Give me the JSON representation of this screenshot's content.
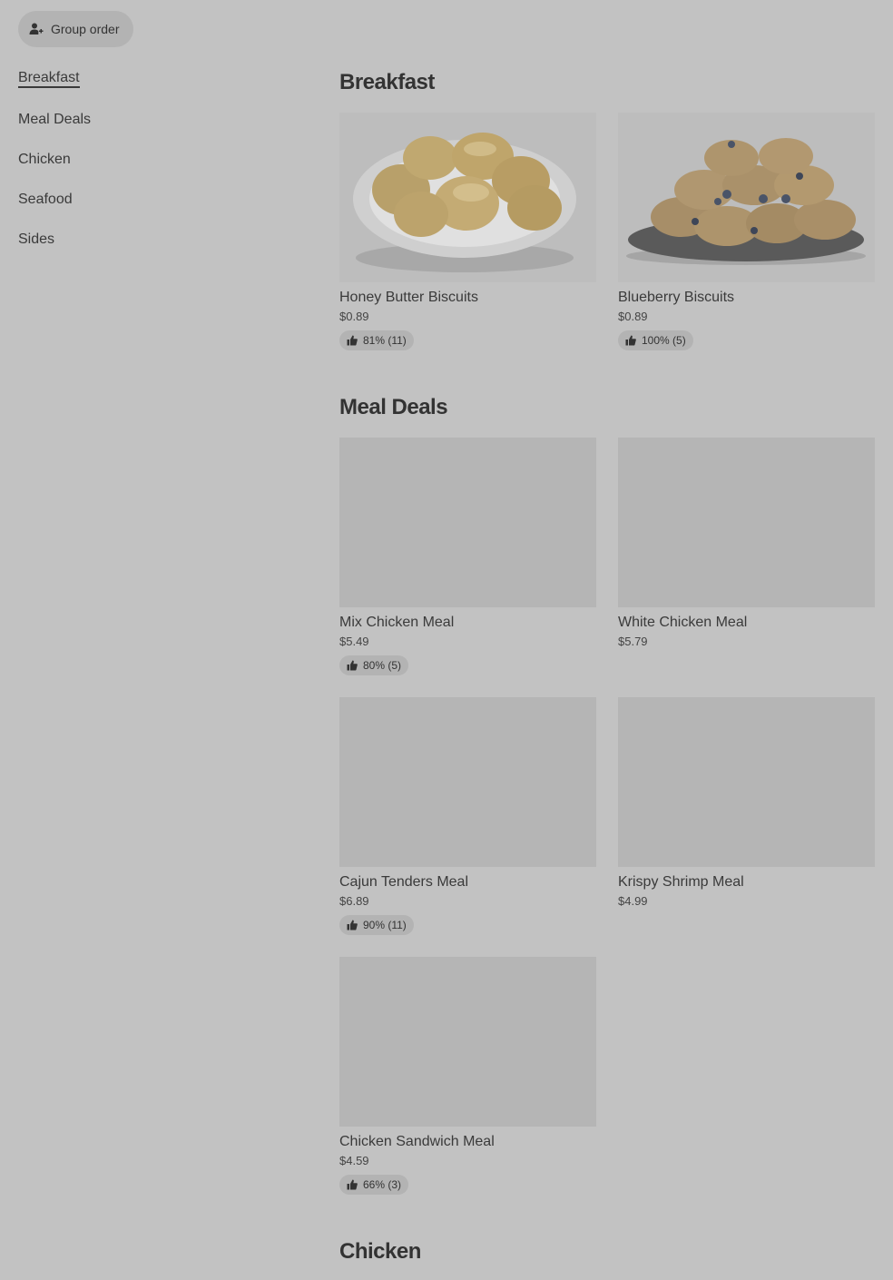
{
  "group_order": {
    "label": "Group order",
    "icon": "person-add-icon"
  },
  "side_nav": {
    "items": [
      {
        "label": "Breakfast",
        "active": true
      },
      {
        "label": "Meal Deals",
        "active": false
      },
      {
        "label": "Chicken",
        "active": false
      },
      {
        "label": "Seafood",
        "active": false
      },
      {
        "label": "Sides",
        "active": false
      }
    ]
  },
  "sections": [
    {
      "title": "Breakfast",
      "items": [
        {
          "name": "Honey Butter Biscuits",
          "price": "$0.89",
          "rating": "81% (11)",
          "image": "honey-butter-biscuits-photo"
        },
        {
          "name": "Blueberry Biscuits",
          "price": "$0.89",
          "rating": "100% (5)",
          "image": "blueberry-biscuits-photo"
        }
      ]
    },
    {
      "title": "Meal Deals",
      "items": [
        {
          "name": "Mix Chicken Meal",
          "price": "$5.49",
          "rating": "80% (5)"
        },
        {
          "name": "White Chicken Meal",
          "price": "$5.79"
        },
        {
          "name": "Cajun Tenders Meal",
          "price": "$6.89",
          "rating": "90% (11)"
        },
        {
          "name": "Krispy Shrimp Meal",
          "price": "$4.99"
        },
        {
          "name": "Chicken Sandwich Meal",
          "price": "$4.59",
          "rating": "66% (3)"
        }
      ]
    },
    {
      "title": "Chicken",
      "items": []
    }
  ],
  "colors": {
    "overlay_background": "#c2c2c2",
    "placeholder_image": "#b5b5b5",
    "pill_background": "#b3b3b3",
    "text": "#3a3a3a"
  }
}
